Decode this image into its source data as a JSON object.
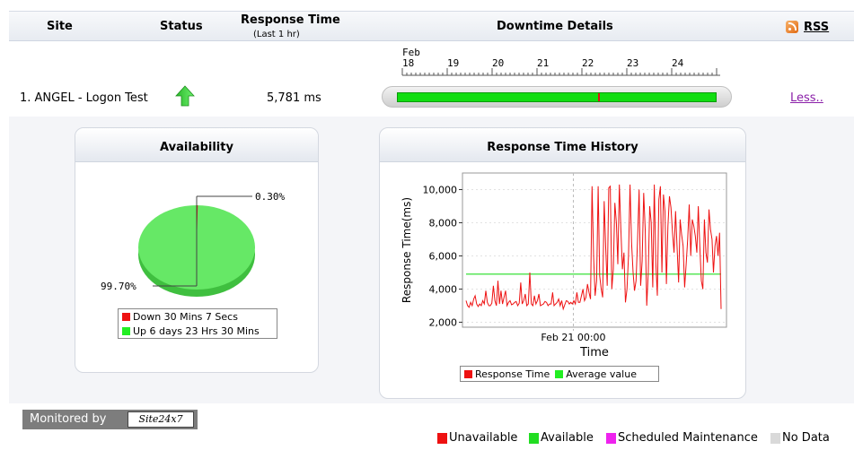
{
  "header": {
    "site": "Site",
    "status": "Status",
    "response_time": "Response Time",
    "response_time_sub": "(Last 1 hr)",
    "downtime_details": "Downtime Details",
    "rss": "RSS"
  },
  "timeline": {
    "month": "Feb",
    "days": [
      "18",
      "19",
      "20",
      "21",
      "22",
      "23",
      "24"
    ],
    "down_fraction": 0.63
  },
  "row": {
    "site_name": "1. ANGEL - Logon Test",
    "status_icon": "up-arrow-icon",
    "response_time": "5,781 ms",
    "less_link": "Less.."
  },
  "availability": {
    "title": "Availability",
    "down_pct_label": "0.30%",
    "up_pct_label": "99.70%",
    "legend": [
      {
        "label": "Down 30 Mins 7 Secs",
        "color": "#ee1111"
      },
      {
        "label": "Up 6 days 23 Hrs 30 Mins",
        "color": "#22ee22"
      }
    ],
    "chart_data": {
      "type": "pie",
      "slices": [
        {
          "name": "Down 30 Mins 7 Secs",
          "value": 0.3,
          "color": "#ee1111"
        },
        {
          "name": "Up 6 days 23 Hrs 30 Mins",
          "value": 99.7,
          "color": "#55e055"
        }
      ]
    }
  },
  "history": {
    "title": "Response Time History",
    "chart_data": {
      "type": "line",
      "xlabel": "Time",
      "ylabel": "Response Time(ms)",
      "x_tick_label": "Feb 21 00:00",
      "x_tick_position": 0.42,
      "ylim": [
        1700,
        11000
      ],
      "yticks": [
        "2,000",
        "4,000",
        "6,000",
        "8,000",
        "10,000"
      ],
      "ytick_values": [
        2000,
        4000,
        6000,
        8000,
        10000
      ],
      "average": 4900,
      "series": [
        {
          "name": "Response Time",
          "color": "#ee1111",
          "values": [
            3300,
            3000,
            2900,
            3200,
            3000,
            3400,
            3600,
            3100,
            2950,
            3100,
            3000,
            3300,
            3100,
            3900,
            3200,
            3000,
            3000,
            3150,
            4200,
            3300,
            3000,
            4500,
            3100,
            3900,
            3100,
            3500,
            3900,
            3000,
            3200,
            3300,
            3050,
            3100,
            3200,
            3250,
            3000,
            3150,
            4400,
            3100,
            3300,
            3700,
            3000,
            3100,
            5000,
            3100,
            3000,
            3600,
            3100,
            3300,
            3700,
            3000,
            3050,
            3100,
            3250,
            3200,
            3000,
            3100,
            3100,
            3800,
            3000,
            3100,
            3200,
            3400,
            3000,
            3300,
            2800,
            3050,
            3300,
            3250,
            3100,
            3200,
            3100,
            3300,
            3100,
            3800,
            3200,
            3200,
            3600,
            4000,
            3300,
            3500,
            4300,
            3800,
            3400,
            10200,
            6000,
            3600,
            4500,
            10200,
            4800,
            4000,
            3500,
            9300,
            6500,
            4200,
            10100,
            10200,
            4000,
            5200,
            9200,
            8000,
            5500,
            10300,
            7600,
            5200,
            6200,
            3200,
            4000,
            6000,
            10300,
            6800,
            5000,
            3900,
            4500,
            7000,
            10000,
            4200,
            5700,
            9800,
            7600,
            3000,
            5000,
            9000,
            8000,
            4100,
            10300,
            5600,
            3600,
            9400,
            10200,
            5000,
            9700,
            8700,
            4300,
            7800,
            9600,
            8900,
            7400,
            6200,
            8700,
            6500,
            4400,
            8200,
            7300,
            6600,
            4100,
            5500,
            7000,
            9100,
            6000,
            8200,
            7800,
            7200,
            6200,
            9000,
            6600,
            4500,
            4000,
            8200,
            6200,
            5600,
            8800,
            7600,
            7000,
            5000,
            6600,
            7200,
            6000,
            7400,
            2800
          ]
        }
      ],
      "average_series": {
        "name": "Average value",
        "color": "#22ee22"
      }
    },
    "legend": [
      {
        "label": "Response Time",
        "color": "#ee1111"
      },
      {
        "label": "Average value",
        "color": "#22ee22"
      }
    ]
  },
  "footer": {
    "monitored_by": "Monitored by",
    "logo_text": "Site24x7",
    "legend": [
      {
        "label": "Unavailable",
        "color": "#ee1111"
      },
      {
        "label": "Available",
        "color": "#22dd22"
      },
      {
        "label": "Scheduled Maintenance",
        "color": "#ee22ee"
      },
      {
        "label": "No Data",
        "color": "#d9d9d9"
      }
    ]
  }
}
